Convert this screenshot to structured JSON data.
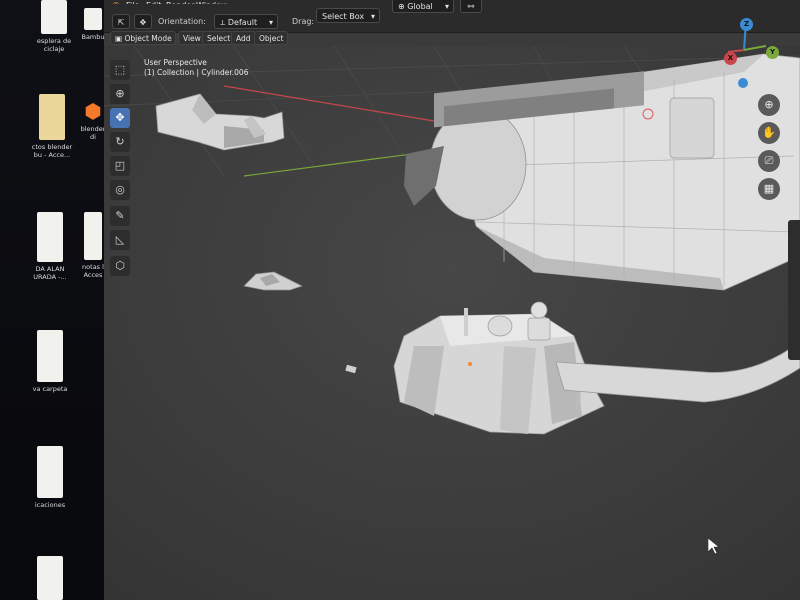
{
  "desktop": {
    "icons": [
      {
        "name": "desktop-file-reciclaje",
        "label": "esplera de\nciclaje"
      },
      {
        "name": "desktop-file-bambu",
        "label": "Bambu"
      },
      {
        "name": "desktop-folder-proyectos",
        "label": "ctos blender\nbu - Acce..."
      },
      {
        "name": "desktop-blender-shortcut",
        "label": "blender\ndi"
      },
      {
        "name": "desktop-file-alan",
        "label": "DA ALAN\nURADA -..."
      },
      {
        "name": "desktop-file-notas",
        "label": "notas l\nAcces"
      },
      {
        "name": "desktop-folder-nueva",
        "label": "va carpeta"
      },
      {
        "name": "desktop-file-aplicaciones",
        "label": "icaciones"
      }
    ]
  },
  "menubar": {
    "items": [
      "File",
      "Edit",
      "Render",
      "Window"
    ]
  },
  "header": {
    "orientation_label": "Orientation:",
    "orientation_value": "Default",
    "drag_label": "Drag:",
    "drag_value": "Select Box",
    "transform_value": "Global"
  },
  "subheader": {
    "mode": "Object Mode",
    "menus": [
      "View",
      "Select",
      "Add",
      "Object"
    ]
  },
  "viewport": {
    "perspective": "User Perspective",
    "collection": "(1) Collection | Cylinder.006"
  },
  "gizmo": {
    "z": "Z",
    "y": "Y",
    "x": "X"
  },
  "colors": {
    "viewport_bg": "#3d3d3d",
    "model": "#d6d6d6",
    "x_axis": "#c8474d",
    "y_axis": "#7aa83a",
    "z_axis": "#3a8bd6",
    "active_tool": "#4772b3"
  }
}
